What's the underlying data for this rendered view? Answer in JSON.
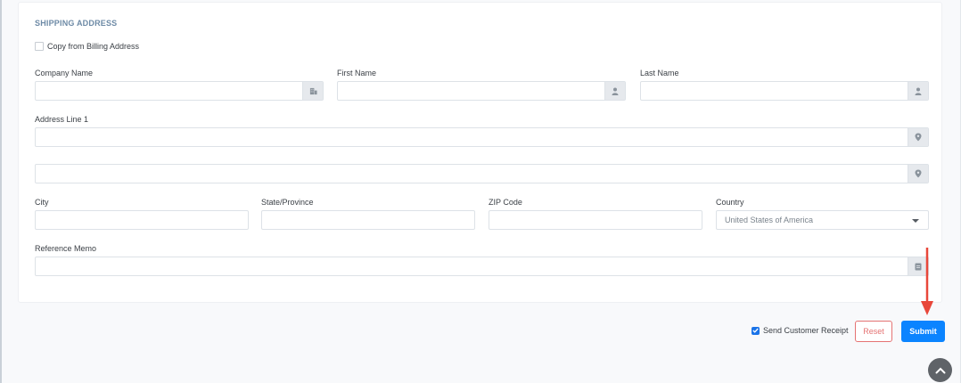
{
  "section": {
    "title": "SHIPPING ADDRESS",
    "copy_label": "Copy from Billing Address"
  },
  "fields": {
    "company_name": {
      "label": "Company Name",
      "value": ""
    },
    "first_name": {
      "label": "First Name",
      "value": ""
    },
    "last_name": {
      "label": "Last Name",
      "value": ""
    },
    "address_line1": {
      "label": "Address Line 1",
      "value": ""
    },
    "address_line2": {
      "value": ""
    },
    "city": {
      "label": "City",
      "value": ""
    },
    "state": {
      "label": "State/Province",
      "value": ""
    },
    "zip": {
      "label": "ZIP Code",
      "value": ""
    },
    "country": {
      "label": "Country",
      "value": "United States of America"
    },
    "memo": {
      "label": "Reference Memo",
      "value": ""
    }
  },
  "footer": {
    "receipt_label": "Send Customer Receipt",
    "reset_label": "Reset",
    "submit_label": "Submit"
  },
  "colors": {
    "primary": "#0b84ff",
    "reset": "#e57373",
    "annotation_arrow": "#e8473a"
  },
  "icons": [
    "building-icon",
    "user-icon",
    "user-icon",
    "location-icon",
    "location-icon",
    "memo-icon",
    "chevron-up-icon"
  ]
}
